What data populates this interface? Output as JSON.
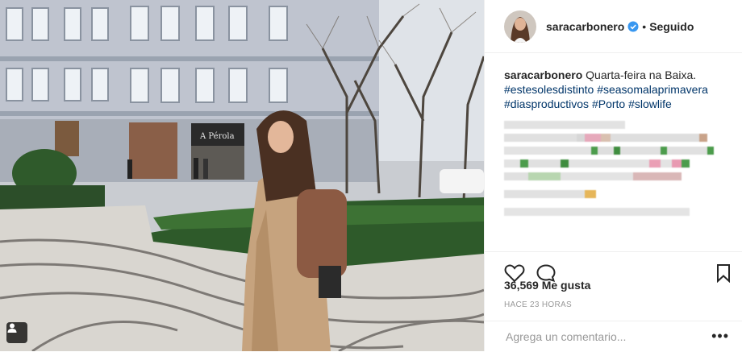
{
  "header": {
    "username": "saracarbonero",
    "separator": "•",
    "follow_state": "Seguido",
    "verified_icon": "verified-badge-icon"
  },
  "caption": {
    "username": "saracarbonero",
    "text": "Quarta-feira na Baixa.",
    "hashtags_line1": [
      "#estesolesdistinto",
      "#seasomalaprimavera"
    ],
    "hashtags_line2": [
      "#diasproductivos",
      "#Porto",
      "#slowlife"
    ]
  },
  "actions": {
    "like_icon": "heart-icon",
    "comment_icon": "comment-icon",
    "save_icon": "bookmark-icon"
  },
  "likes": {
    "count": "36,569",
    "label": "Me gusta"
  },
  "timestamp": "HACE 23 HORAS",
  "comment_box": {
    "placeholder": "Agrega un comentario...",
    "more_label": "•••"
  },
  "colors": {
    "text": "#262626",
    "hashtag": "#003569",
    "muted": "#999999",
    "verified": "#3897f0",
    "border": "#efefef"
  }
}
